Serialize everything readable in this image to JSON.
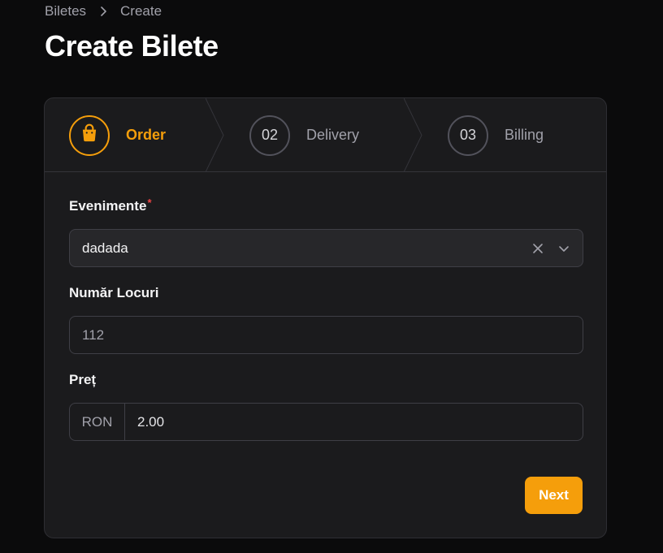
{
  "breadcrumb": {
    "items": [
      "Biletes",
      "Create"
    ]
  },
  "page": {
    "title": "Create Bilete"
  },
  "wizard": {
    "steps": [
      {
        "number": "",
        "label": "Order",
        "icon": "shopping-bag-icon",
        "active": true
      },
      {
        "number": "02",
        "label": "Delivery",
        "active": false
      },
      {
        "number": "03",
        "label": "Billing",
        "active": false
      }
    ]
  },
  "form": {
    "evenimente": {
      "label": "Evenimente",
      "required_mark": "*",
      "value": "dadada"
    },
    "numar_locuri": {
      "label": "Număr Locuri",
      "placeholder": "112"
    },
    "pret": {
      "label": "Preț",
      "prefix": "RON",
      "value": "2.00"
    }
  },
  "actions": {
    "next_label": "Next"
  },
  "colors": {
    "accent": "#f59e0b",
    "background": "#0b0b0c",
    "card": "#1b1b1d",
    "required": "#ef4444"
  }
}
